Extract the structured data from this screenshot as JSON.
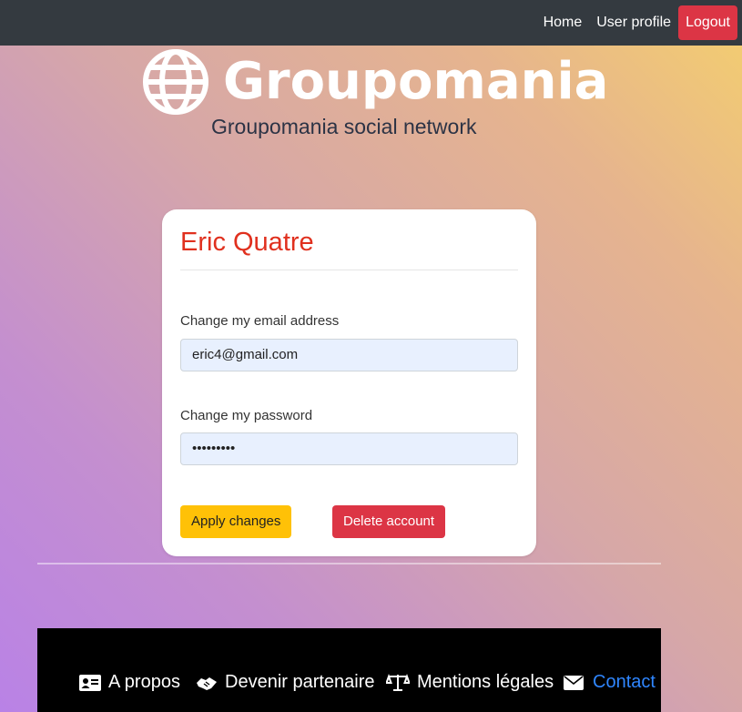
{
  "nav": {
    "home": "Home",
    "user_profile": "User profile",
    "logout": "Logout"
  },
  "brand": {
    "name": "Groupomania",
    "tagline": "Groupomania social network",
    "logo_icon": "globe-icon"
  },
  "profile_card": {
    "name": "Eric Quatre",
    "email_label": "Change my email address",
    "email_value": "eric4@gmail.com",
    "password_label": "Change my password",
    "password_value": "•••••••••",
    "apply_label": "Apply changes",
    "delete_label": "Delete account"
  },
  "footer": {
    "items": [
      {
        "label": "A propos",
        "icon": "id-card-icon"
      },
      {
        "label": "Devenir partenaire",
        "icon": "handshake-icon"
      },
      {
        "label": "Mentions légales",
        "icon": "scale-icon"
      },
      {
        "label": "Contact",
        "icon": "envelope-icon"
      }
    ]
  },
  "colors": {
    "nav_bg": "#343a40",
    "logout_bg": "#dc3545",
    "title_red": "#e0301e",
    "apply_yellow": "#ffc107",
    "delete_red": "#dc3545",
    "contact_blue": "#2f86ff",
    "input_bg": "#e8f0fe"
  }
}
